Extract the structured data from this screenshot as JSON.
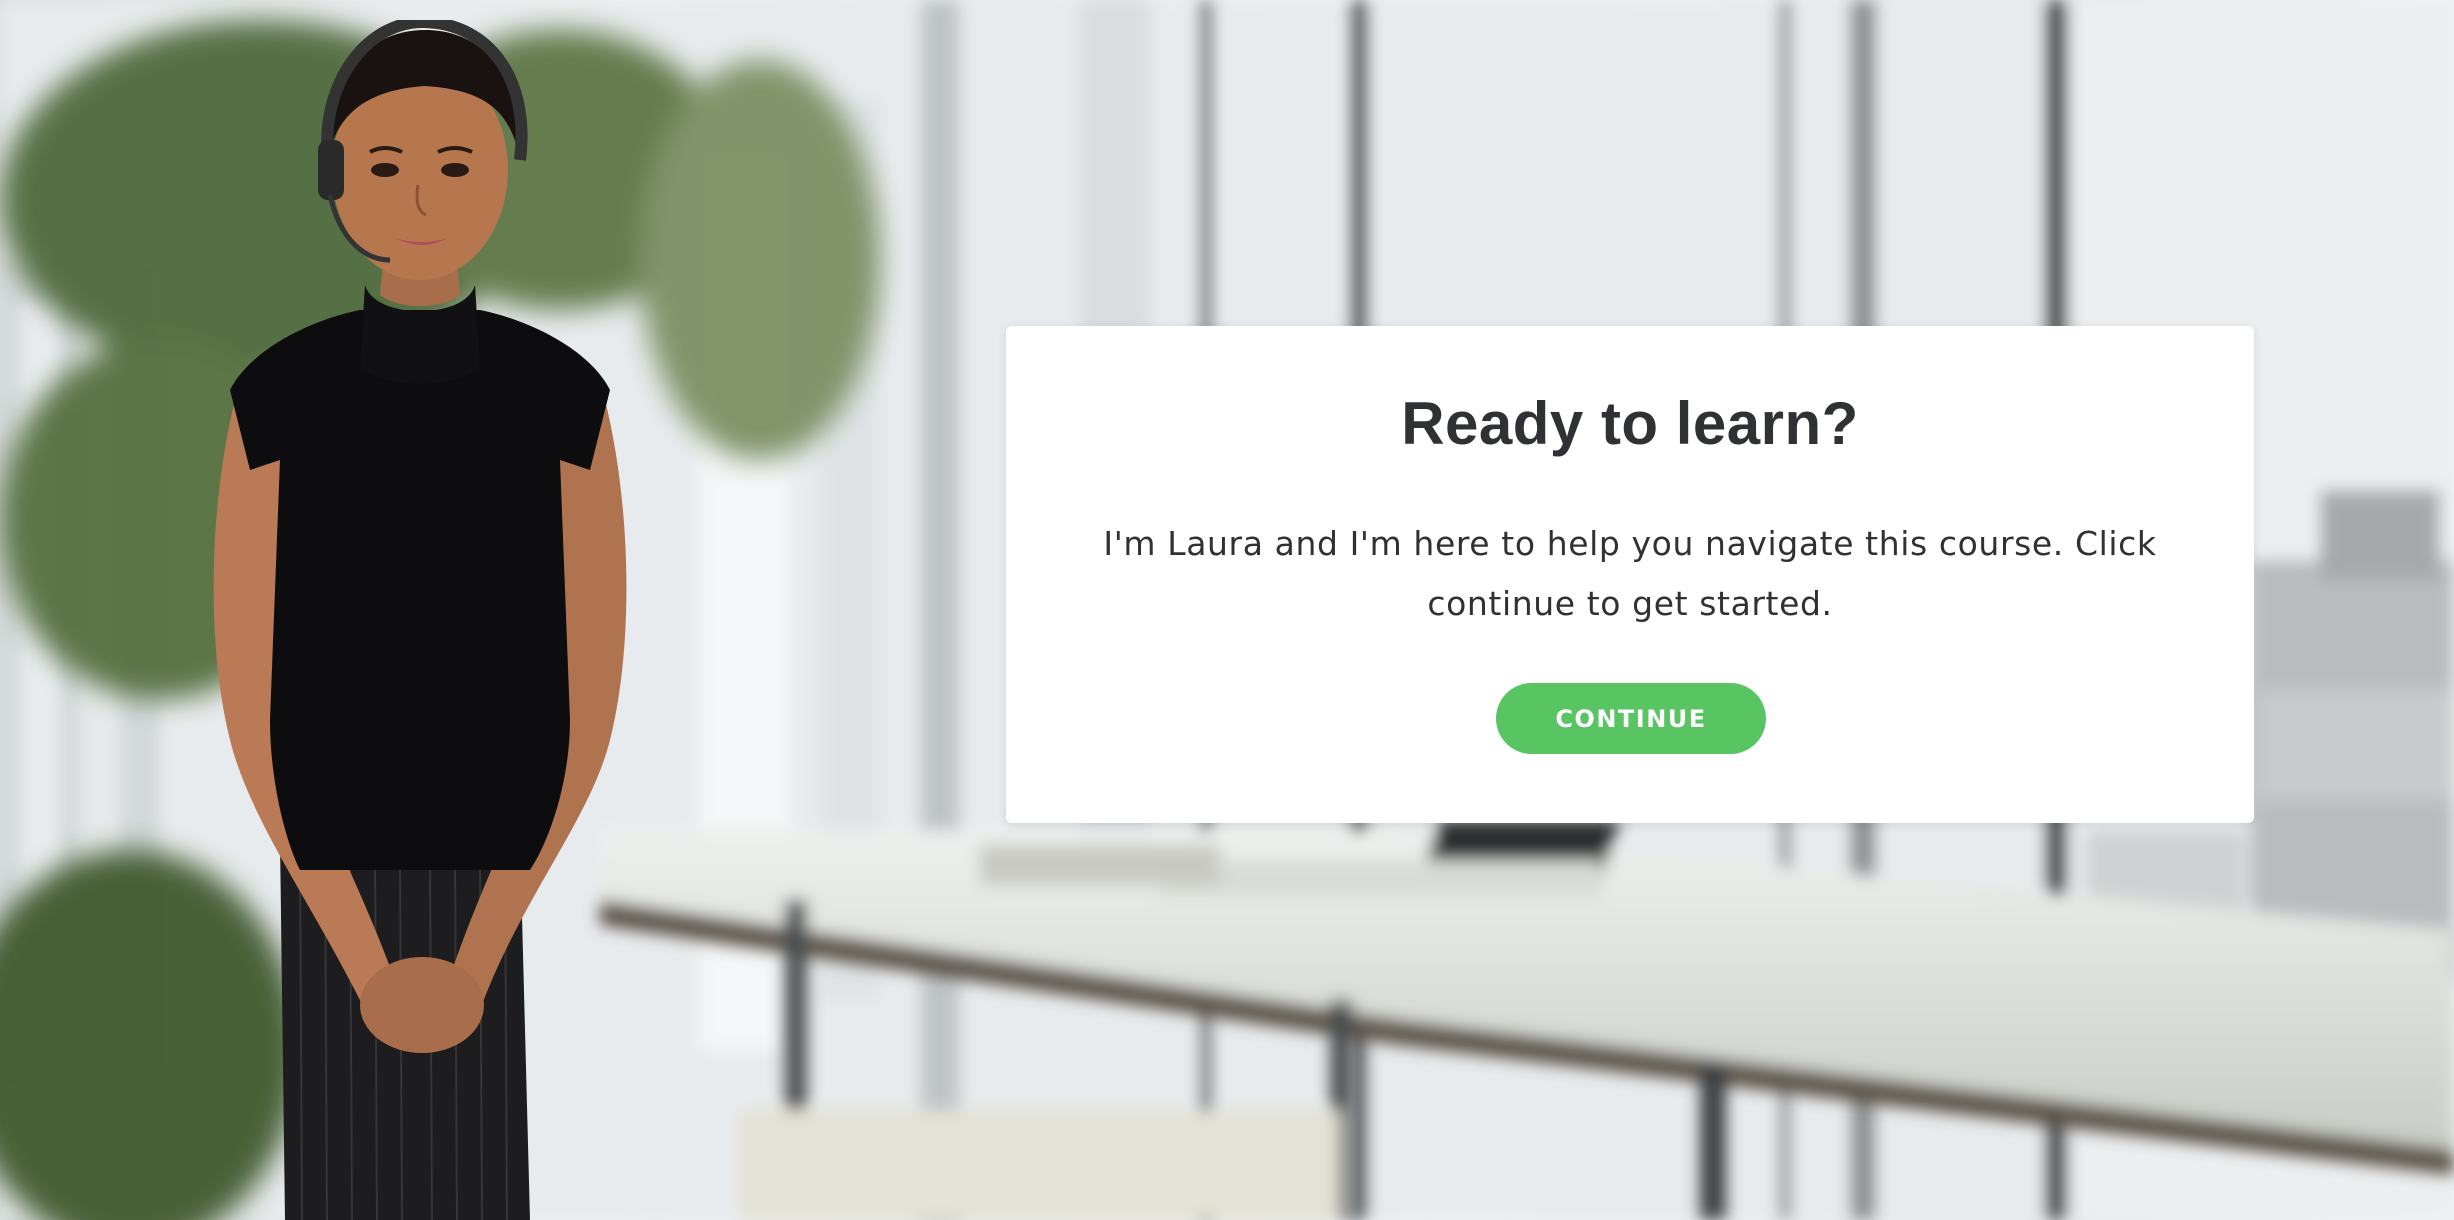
{
  "dialog": {
    "title": "Ready to learn?",
    "body": "I'm Laura and I'm here to help you navigate this course. Click continue to get started.",
    "continue_label": "CONTINUE"
  },
  "character": {
    "icon": "presenter-avatar"
  },
  "colors": {
    "button": "#58c462",
    "button_text": "#ffffff",
    "text": "#2f3134",
    "card": "#ffffff"
  }
}
